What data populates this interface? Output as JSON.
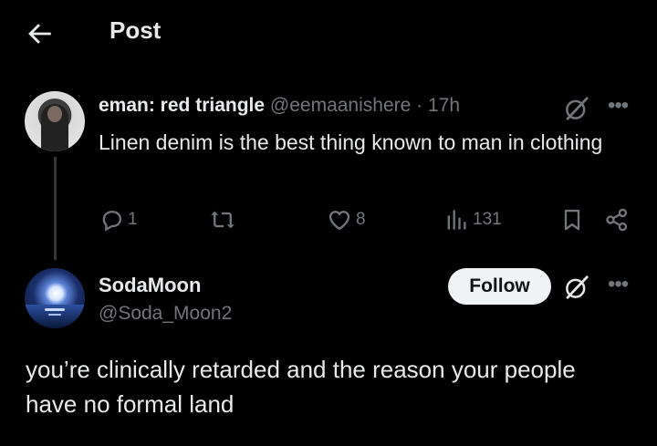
{
  "header": {
    "title": "Post",
    "back_icon": "arrow-left-icon"
  },
  "parent_post": {
    "display_name": "eman: red triangle",
    "handle": "@eemaanishere",
    "separator": "·",
    "time": "17h",
    "text": "Linen denim is the best thing known to man in clothing",
    "actions": {
      "replies": "1",
      "reposts": "",
      "likes": "8",
      "views": "131"
    }
  },
  "reply_post": {
    "display_name": "SodaMoon",
    "handle": "@Soda_Moon2",
    "follow_label": "Follow",
    "text": "you’re clinically retarded and the reason your people have no formal land"
  },
  "colors": {
    "background": "#000000",
    "primary_text": "#e7e9ea",
    "secondary_text": "#71767b",
    "follow_bg": "#eff3f4",
    "follow_text": "#0f1419"
  }
}
